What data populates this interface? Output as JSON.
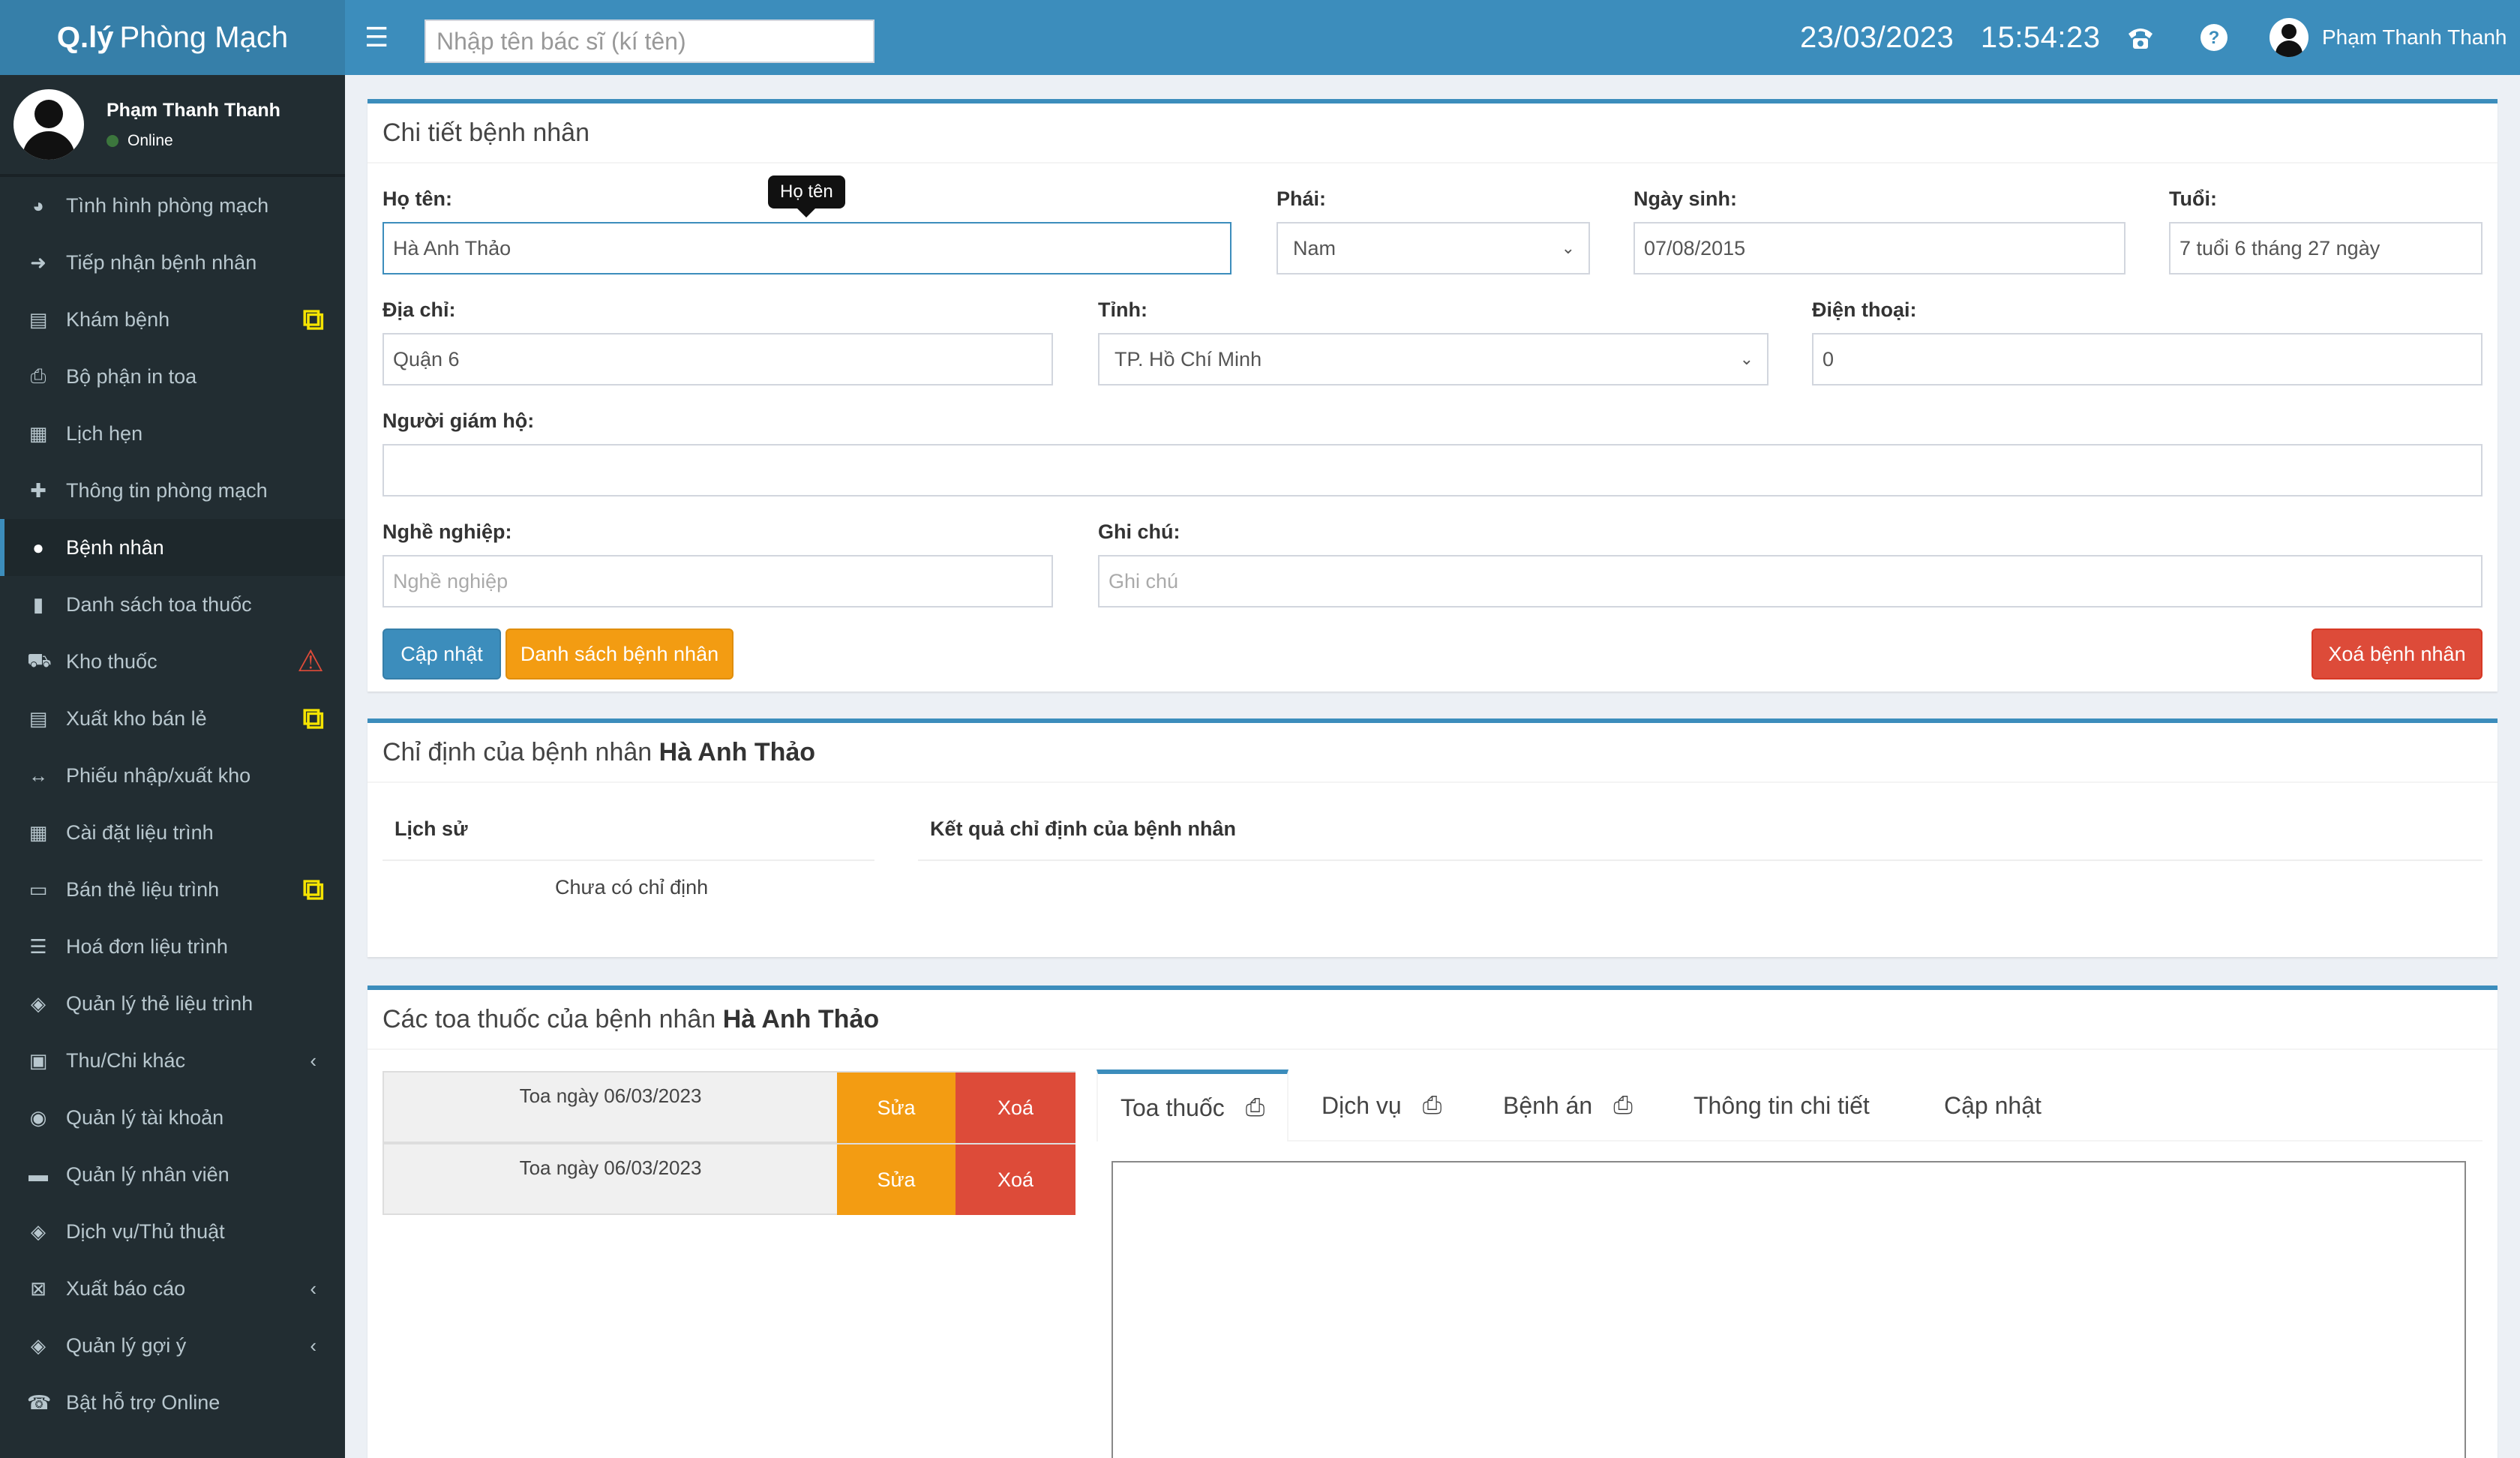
{
  "header": {
    "logo_bold": "Q.lý",
    "logo_light": "Phòng Mạch",
    "search_placeholder": "Nhập tên bác sĩ (kí tên)",
    "date": "23/03/2023",
    "time": "15:54:23",
    "user_name": "Phạm Thanh Thanh",
    "icons": [
      "menu-icon",
      "phone-icon",
      "help-icon",
      "user-avatar"
    ]
  },
  "sidebar": {
    "user_name": "Phạm Thanh Thanh",
    "status": "Online",
    "items": [
      {
        "label": "Tình hình phòng mạch",
        "icon": "pie-chart-icon"
      },
      {
        "label": "Tiếp nhận bệnh nhân",
        "icon": "sign-in-icon"
      },
      {
        "label": "Khám bệnh",
        "icon": "clipboard-icon",
        "badge": "external-link"
      },
      {
        "label": "Bộ phận in toa",
        "icon": "print-icon"
      },
      {
        "label": "Lịch hẹn",
        "icon": "calendar-icon"
      },
      {
        "label": "Thông tin phòng mạch",
        "icon": "plus-icon"
      },
      {
        "label": "Bệnh nhân",
        "icon": "user-icon",
        "active": true
      },
      {
        "label": "Danh sách toa thuốc",
        "icon": "file-icon"
      },
      {
        "label": "Kho thuốc",
        "icon": "ambulance-icon",
        "badge": "warning"
      },
      {
        "label": "Xuất kho bán lẻ",
        "icon": "clipboard-icon",
        "badge": "external-link"
      },
      {
        "label": "Phiếu nhập/xuất kho",
        "icon": "arrows-h-icon"
      },
      {
        "label": "Cài đặt liệu trình",
        "icon": "table-icon"
      },
      {
        "label": "Bán thẻ liệu trình",
        "icon": "credit-card-icon",
        "badge": "external-link"
      },
      {
        "label": "Hoá đơn liệu trình",
        "icon": "list-icon"
      },
      {
        "label": "Quản lý thẻ liệu trình",
        "icon": "tags-icon"
      },
      {
        "label": "Thu/Chi khác",
        "icon": "money-icon",
        "chevron": true
      },
      {
        "label": "Quản lý tài khoản",
        "icon": "users-icon"
      },
      {
        "label": "Quản lý nhân viên",
        "icon": "briefcase-icon"
      },
      {
        "label": "Dịch vụ/Thủ thuật",
        "icon": "tags-icon"
      },
      {
        "label": "Xuất báo cáo",
        "icon": "excel-icon",
        "chevron": true
      },
      {
        "label": "Quản lý gợi ý",
        "icon": "tags-icon",
        "chevron": true
      },
      {
        "label": "Bật hỗ trợ Online",
        "icon": "phone-icon"
      }
    ]
  },
  "patient_detail": {
    "title": "Chi tiết bệnh nhân",
    "tooltip": "Họ tên",
    "name_label": "Họ tên:",
    "name_value": "Hà Anh Thảo",
    "gender_label": "Phái:",
    "gender_value": "Nam",
    "dob_label": "Ngày sinh:",
    "dob_value": "07/08/2015",
    "age_label": "Tuổi:",
    "age_value": "7 tuổi 6 tháng 27 ngày",
    "address_label": "Địa chỉ:",
    "address_value": "Quận 6",
    "province_label": "Tỉnh:",
    "province_value": "TP. Hồ Chí Minh",
    "phone_label": "Điện thoại:",
    "phone_value": "0",
    "guardian_label": "Người giám hộ:",
    "guardian_value": "",
    "job_label": "Nghề nghiệp:",
    "job_placeholder": "Nghề nghiệp",
    "note_label": "Ghi chú:",
    "note_placeholder": "Ghi chú",
    "update_button": "Cập nhật",
    "list_button": "Danh sách bệnh nhân",
    "delete_button": "Xoá bệnh nhân"
  },
  "indications": {
    "title_prefix": "Chỉ định của bệnh nhân",
    "patient_name": "Hà Anh Thảo",
    "history_header": "Lịch sử",
    "result_header": "Kết quả chỉ định của bệnh nhân",
    "empty": "Chưa có chỉ định"
  },
  "prescriptions": {
    "title_prefix": "Các toa thuốc của bệnh nhân",
    "patient_name": "Hà Anh Thảo",
    "rows": [
      {
        "label": "Toa ngày 06/03/2023",
        "edit": "Sửa",
        "delete": "Xoá"
      },
      {
        "label": "Toa ngày 06/03/2023",
        "edit": "Sửa",
        "delete": "Xoá"
      }
    ],
    "tabs": [
      {
        "label": "Toa thuốc",
        "printer": true,
        "active": true
      },
      {
        "label": "Dịch vụ",
        "printer": true
      },
      {
        "label": "Bệnh án",
        "printer": true
      },
      {
        "label": "Thông tin chi tiết"
      },
      {
        "label": "Cập nhật"
      }
    ]
  },
  "colors": {
    "header_bg": "#3c8dbc",
    "logo_bg": "#367fa9",
    "sidebar_bg": "#222d32",
    "orange": "#f39c12",
    "red": "#dd4b39",
    "badge_yellow": "#f6e400"
  }
}
